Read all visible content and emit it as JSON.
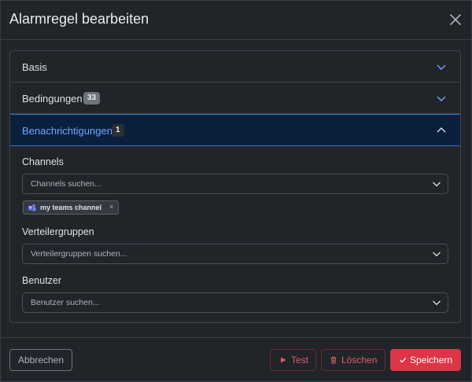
{
  "dialog": {
    "title": "Alarmregel bearbeiten",
    "close_icon": "close-icon"
  },
  "accordion": {
    "sections": [
      {
        "label": "Basis",
        "badge": null,
        "expanded": false
      },
      {
        "label": "Bedingungen",
        "badge": "33",
        "expanded": false
      },
      {
        "label": "Benachrichtigungen",
        "badge": "1",
        "expanded": true
      }
    ]
  },
  "notifications": {
    "channels": {
      "label": "Channels",
      "placeholder": "Channels suchen...",
      "selected": [
        {
          "name": "my teams channel",
          "icon": "teams-icon",
          "remove": "×"
        }
      ]
    },
    "groups": {
      "label": "Verteilergruppen",
      "placeholder": "Verteilergruppen suchen..."
    },
    "users": {
      "label": "Benutzer",
      "placeholder": "Benutzer suchen..."
    }
  },
  "footer": {
    "cancel_label": "Abbrechen",
    "test_label": "Test",
    "delete_label": "Löschen",
    "save_label": "Speichern"
  },
  "colors": {
    "background": "#212429",
    "accent_blue": "#6ea8fe",
    "active_section_bg": "#0b1f3d",
    "danger": "#dc3545",
    "danger_text": "#e35d6a"
  }
}
